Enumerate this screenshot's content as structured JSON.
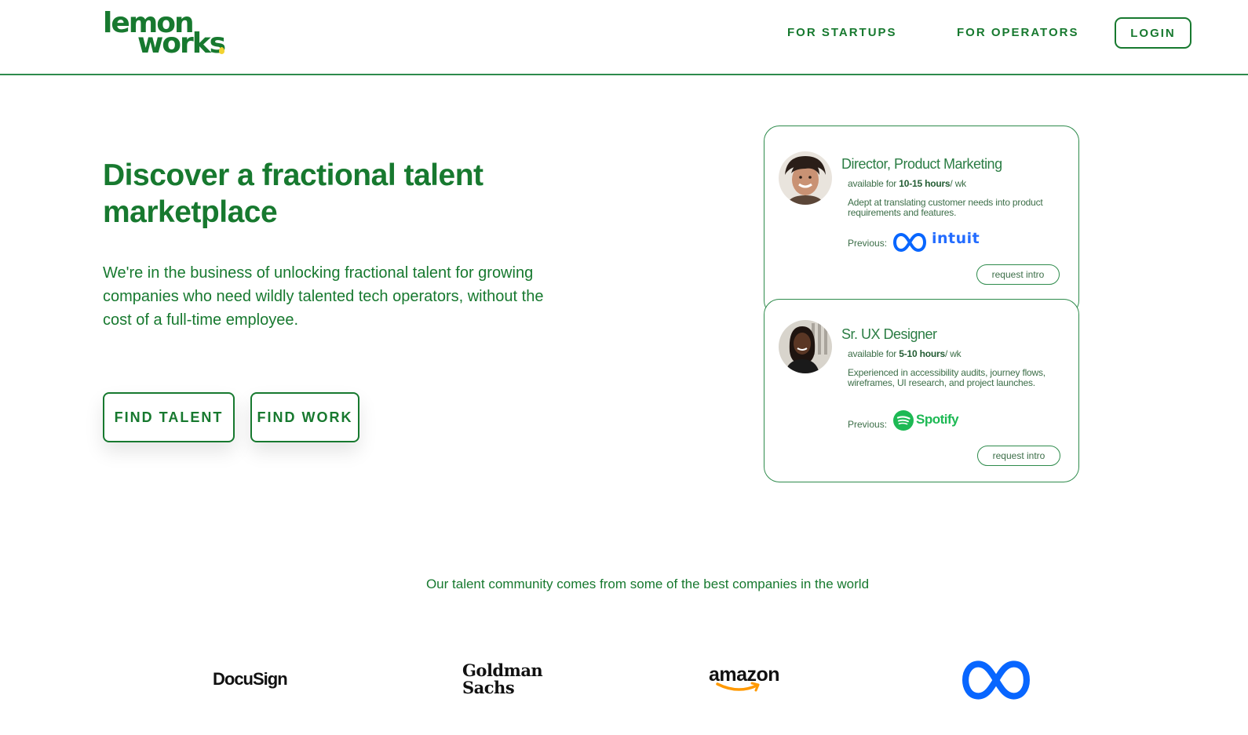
{
  "header": {
    "logo_line1": "lemon",
    "logo_line2": "works",
    "nav": [
      "FOR STARTUPS",
      "FOR OPERATORS"
    ],
    "login_label": "LOGIN"
  },
  "hero": {
    "title": "Discover a fractional talent marketplace",
    "description": "We're in the business of unlocking fractional talent for growing companies who need wildly talented tech operators, without the cost of a full-time employee.",
    "find_talent_label": "FIND TALENT",
    "find_work_label": "FIND WORK"
  },
  "cards": [
    {
      "title": "Director, Product Marketing",
      "avail_prefix": "available for ",
      "avail_hours": "10-15 hours",
      "avail_suffix": "/ wk",
      "description": "Adept at translating customer needs into product requirements and features.",
      "previous_label": "Previous:",
      "previous_companies": [
        "meta-icon",
        "intuit"
      ],
      "intuit_text": "intuit",
      "button_label": "request intro"
    },
    {
      "title": "Sr. UX Designer",
      "avail_prefix": "available for ",
      "avail_hours": "5-10 hours",
      "avail_suffix": "/ wk",
      "description": "Experienced in accessibility audits, journey flows, wireframes, UI research, and project launches.",
      "previous_label": "Previous:",
      "previous_companies": [
        "spotify"
      ],
      "spotify_text": "Spotify",
      "button_label": "request intro"
    }
  ],
  "companies": {
    "title": "Our talent community comes from some of the best companies in the world",
    "docusign": "DocuSign",
    "goldman_line1": "Goldman",
    "goldman_line2": "Sachs",
    "amazon": "amazon",
    "meta_icon": "meta-logo-icon"
  },
  "colors": {
    "brand_green": "#17792f",
    "border_green": "#2e8b4c",
    "logo_dot": "#f2d331",
    "meta_blue": "#0866ff",
    "intuit_blue": "#236cff",
    "spotify_green": "#1db954",
    "amazon_orange": "#ff9900"
  }
}
